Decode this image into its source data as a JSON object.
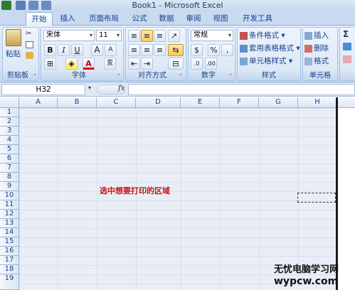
{
  "window": {
    "title": "Book1 - Microsoft Excel"
  },
  "tabs": [
    "开始",
    "插入",
    "页面布局",
    "公式",
    "数据",
    "审阅",
    "视图",
    "开发工具"
  ],
  "ribbon": {
    "clipboard": {
      "label": "剪贴板",
      "paste": "粘贴"
    },
    "font": {
      "label": "字体",
      "name": "宋体",
      "size": "11",
      "bold": "B",
      "italic": "I",
      "underline": "U",
      "grow": "A",
      "shrink": "A",
      "color_letter": "A",
      "wen": "变"
    },
    "alignment": {
      "label": "对齐方式"
    },
    "number": {
      "label": "数字",
      "format": "常规",
      "percent": "%",
      "comma": ","
    },
    "styles": {
      "label": "样式",
      "conditional": "条件格式",
      "table": "套用表格格式",
      "cell": "单元格样式"
    },
    "cells": {
      "label": "单元格",
      "insert": "插入",
      "delete": "删除",
      "format": "格式"
    },
    "editing": {
      "sigma": "Σ"
    }
  },
  "formula_bar": {
    "name_box": "H32",
    "fx": "fx"
  },
  "grid": {
    "columns": [
      "A",
      "B",
      "C",
      "D",
      "E",
      "F",
      "G",
      "H"
    ],
    "rows": [
      "1",
      "2",
      "3",
      "4",
      "5",
      "6",
      "7",
      "8",
      "9",
      "10",
      "11",
      "12",
      "13",
      "14",
      "15",
      "16",
      "17",
      "18",
      "19"
    ]
  },
  "annotation": "选中想要打印的区域",
  "watermark": {
    "line1": "无忧电脑学习网",
    "line2": "wypcw.com"
  },
  "colors": {
    "print_border": "#1a1a1a",
    "annotation": "#c0161b",
    "selected_button": "#f9c85d"
  }
}
